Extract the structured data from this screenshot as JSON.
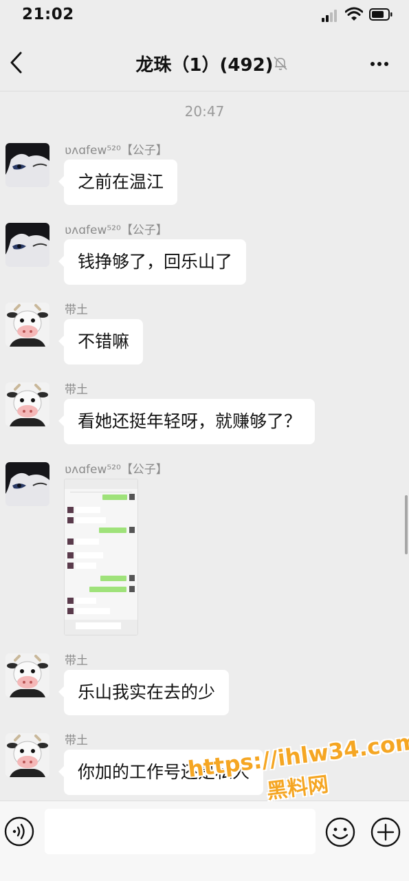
{
  "status_bar": {
    "time": "21:02"
  },
  "nav": {
    "title": "龙珠（1）(492)"
  },
  "timestamp": "20:47",
  "messages": [
    {
      "sender": "ʋʌɑfew⁵²⁰【公子】",
      "avatar": "anime-avatar",
      "text": "之前在温江"
    },
    {
      "sender": "ʋʌɑfew⁵²⁰【公子】",
      "avatar": "anime-avatar",
      "text": "钱挣够了，回乐山了"
    },
    {
      "sender": "带土",
      "avatar": "cow-avatar",
      "text": "不错嘛"
    },
    {
      "sender": "带土",
      "avatar": "cow-avatar",
      "text": "看她还挺年轻呀，就赚够了？"
    },
    {
      "sender": "ʋʌɑfew⁵²⁰【公子】",
      "avatar": "anime-avatar",
      "image": "screenshot-thumbnail"
    },
    {
      "sender": "带土",
      "avatar": "cow-avatar",
      "text": "乐山我实在去的少"
    },
    {
      "sender": "带土",
      "avatar": "cow-avatar",
      "text": "你加的工作号还是私人"
    }
  ],
  "watermark": {
    "url": "https://ihlw34.com",
    "site": "黑料网"
  },
  "colors": {
    "background": "#ededed",
    "bubble": "#ffffff",
    "watermark": "#f5a623"
  }
}
